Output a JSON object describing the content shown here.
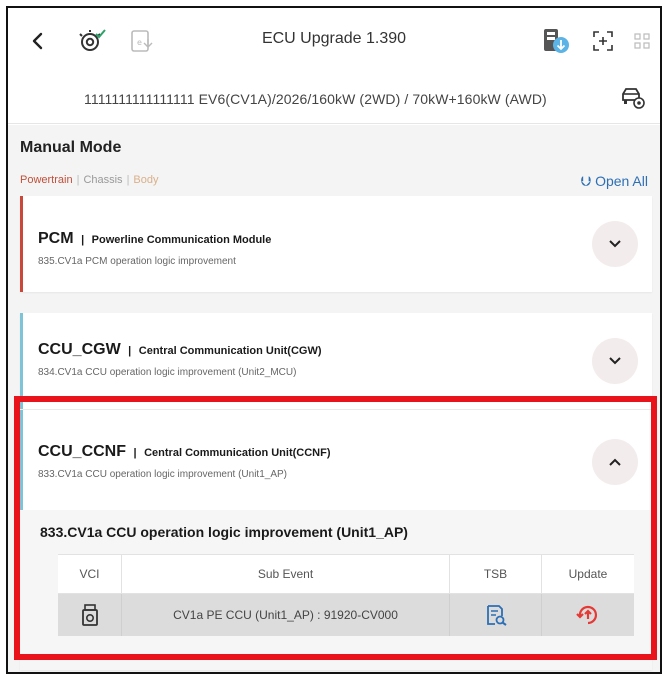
{
  "header": {
    "title": "ECU Upgrade 1.390",
    "back_icon": "chevron-left-icon",
    "icons": [
      "settings-check-icon",
      "ev-export-icon",
      "download-cloud-icon",
      "fullscreen-icon",
      "grid-icon"
    ]
  },
  "vehicle": {
    "info": "1111111111111111  EV6(CV1A)/2026/160kW (2WD) / 70kW+160kW (AWD)",
    "icon": "car-settings-icon"
  },
  "mode": {
    "title": "Manual Mode",
    "filters": [
      "Powertrain",
      "Chassis",
      "Body"
    ],
    "open_all": "Open All"
  },
  "modules": [
    {
      "code": "PCM",
      "name": "Powerline Communication Module",
      "sub": "835.CV1a PCM operation logic improvement",
      "stripe": "#c9483a",
      "expanded": false
    },
    {
      "code": "CCU_CGW",
      "name": "Central Communication Unit(CGW)",
      "sub": "834.CV1a CCU operation logic improvement (Unit2_MCU)",
      "stripe": "#7ec4d6",
      "expanded": false
    },
    {
      "code": "CCU_CCNF",
      "name": "Central Communication Unit(CCNF)",
      "sub": "833.CV1a CCU operation logic improvement (Unit1_AP)",
      "stripe": "#7ec4d6",
      "expanded": true
    }
  ],
  "detail": {
    "title": "833.CV1a CCU operation logic improvement (Unit1_AP)",
    "columns": [
      "VCI",
      "Sub Event",
      "TSB",
      "Update"
    ],
    "rows": [
      {
        "vci_icon": "vci-device-icon",
        "sub_event": "CV1a PE CCU (Unit1_AP) : 91920-CV000",
        "tsb_icon": "document-search-icon",
        "update_icon": "update-upload-icon"
      }
    ]
  },
  "colors": {
    "accent": "#2d6fb5",
    "update_red": "#e53935",
    "highlight": "#e8131b"
  }
}
